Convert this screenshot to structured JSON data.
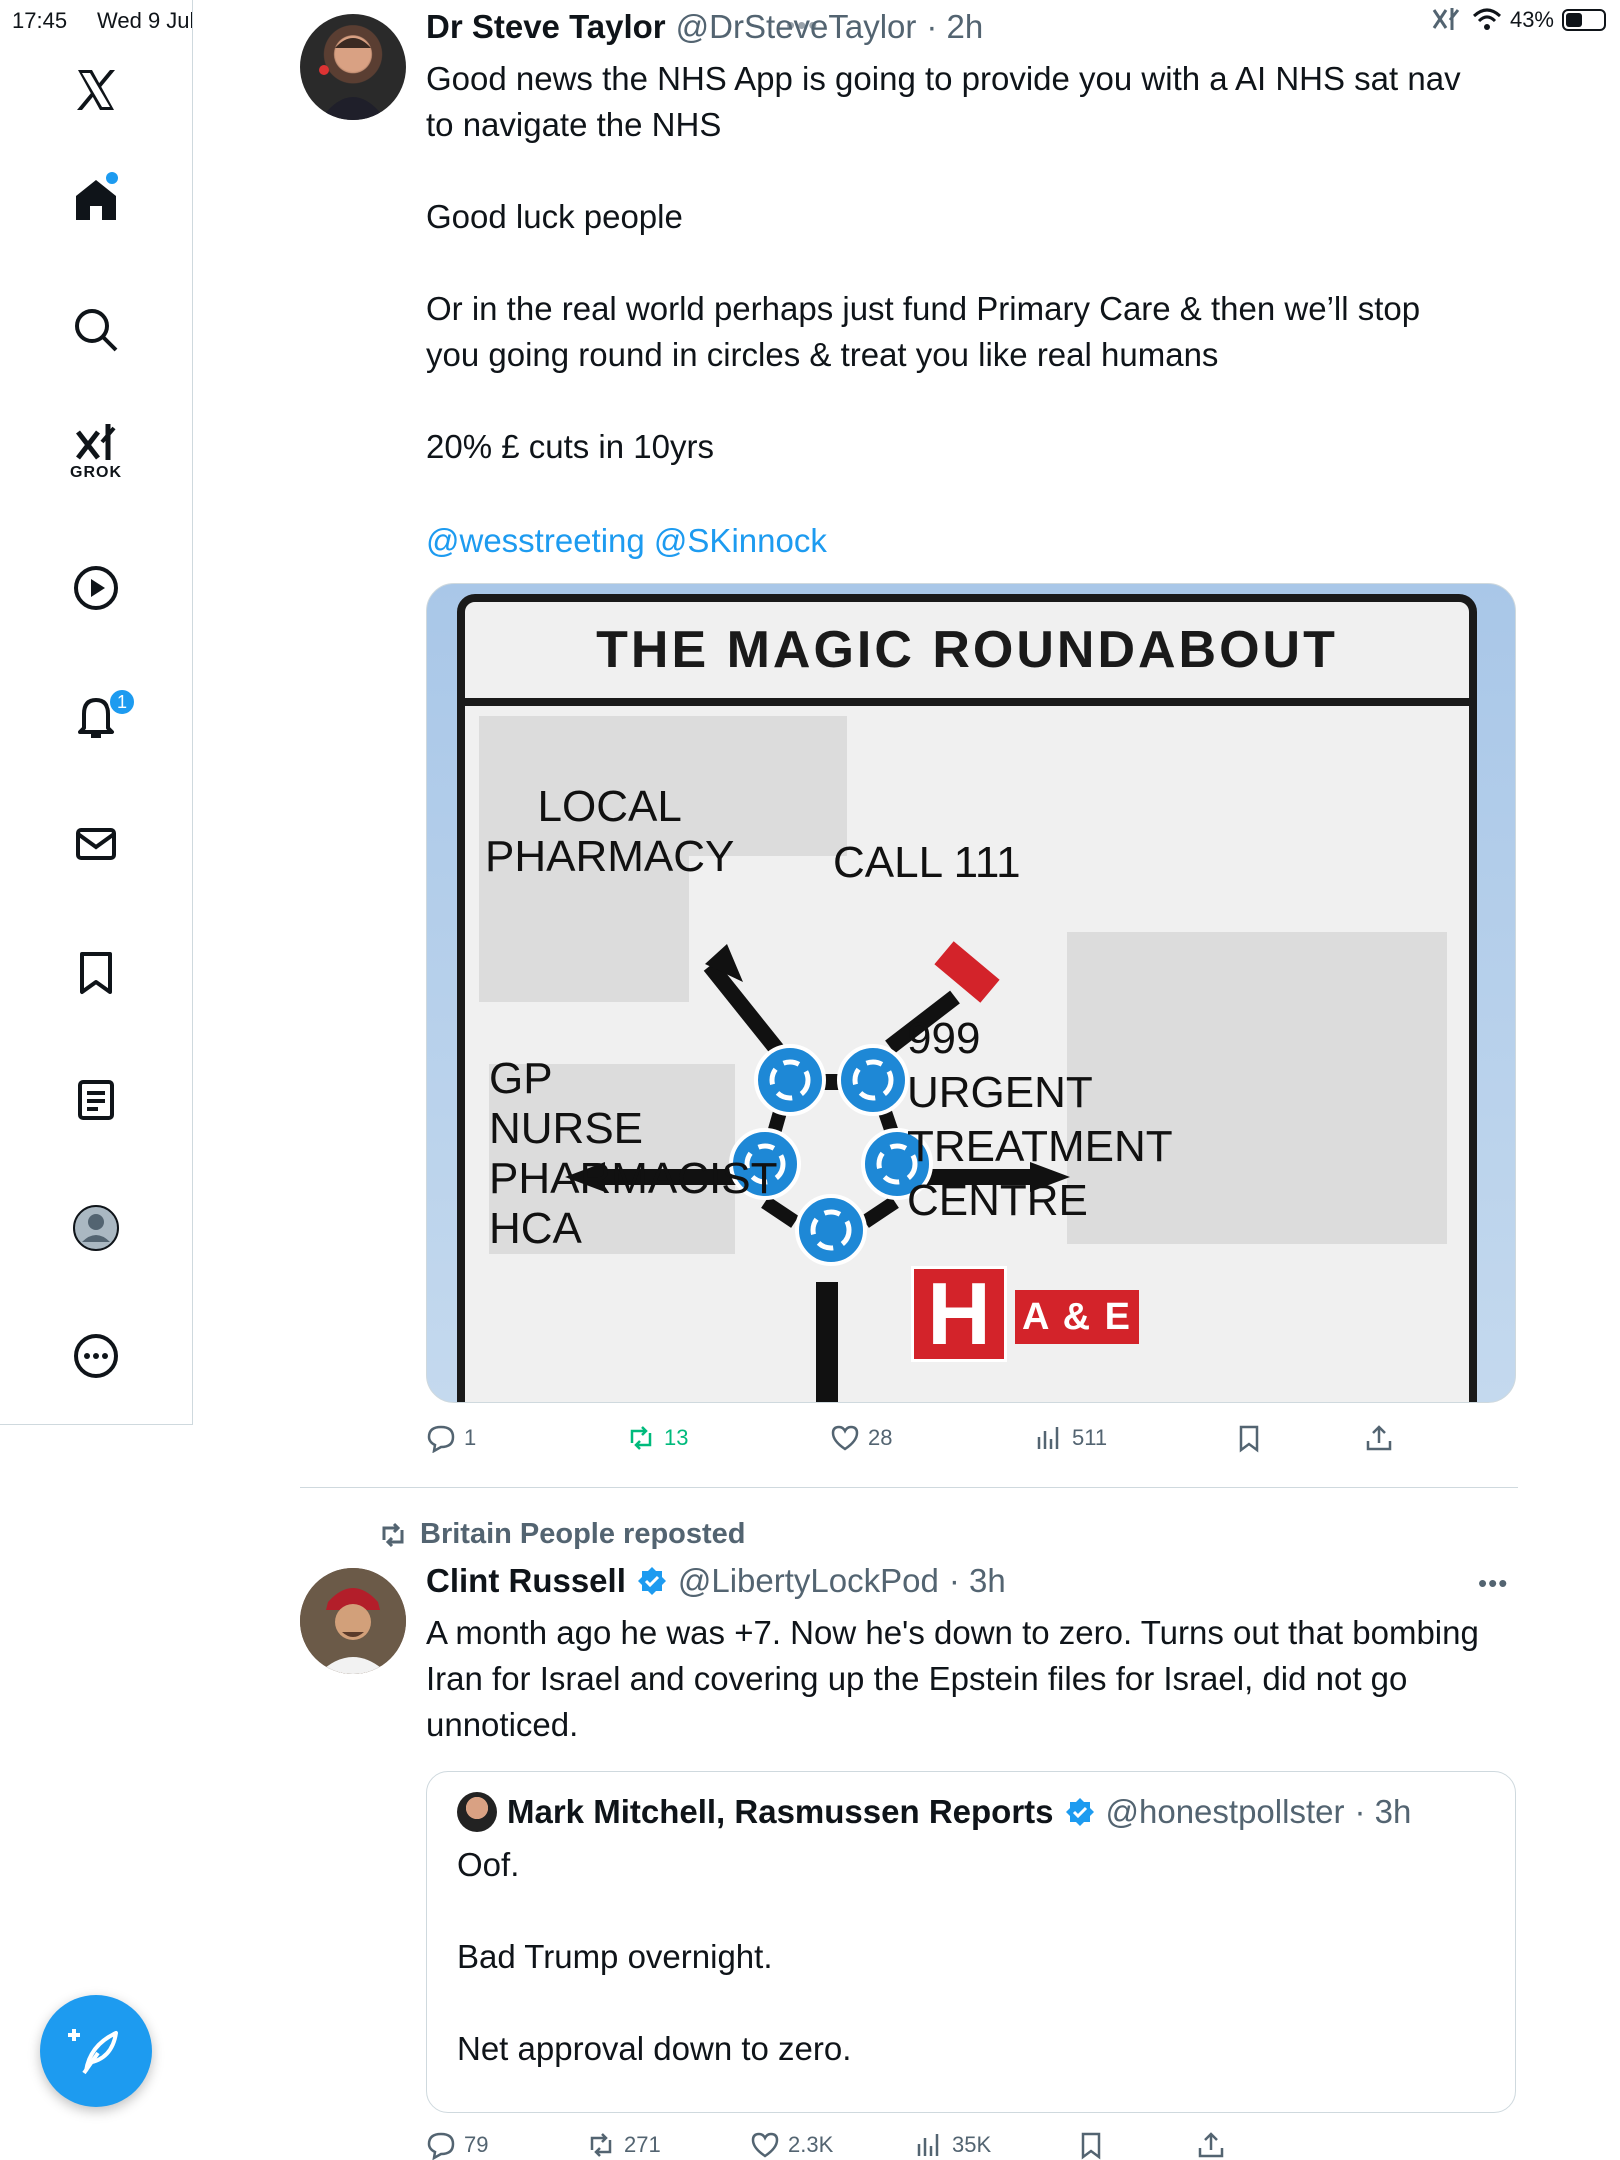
{
  "status_bar": {
    "time": "17:45",
    "date": "Wed 9 Jul",
    "battery": "43%"
  },
  "sidebar": {
    "items": [
      {
        "name": "x-logo"
      },
      {
        "name": "home"
      },
      {
        "name": "explore"
      },
      {
        "name": "grok",
        "label": "GROK"
      },
      {
        "name": "video"
      },
      {
        "name": "notifications",
        "badge": "1"
      },
      {
        "name": "messages"
      },
      {
        "name": "bookmarks"
      },
      {
        "name": "lists"
      },
      {
        "name": "profile"
      },
      {
        "name": "more"
      }
    ]
  },
  "post1": {
    "author": "Dr Steve Taylor",
    "handle": "@DrSteveTaylor",
    "time": "· 2h",
    "text": "Good news the NHS App is going to provide you with a AI NHS sat nav\nto navigate the NHS\n\nGood luck people\n\nOr in the real world perhaps just fund Primary Care & then we’ll stop\nyou going round in circles & treat you like real humans\n\n20% £ cuts in 10yrs",
    "mentions": "@wesstreeting @SKinnock",
    "image": {
      "title": "THE MAGIC ROUNDABOUT",
      "local": "LOCAL\nPHARMACY",
      "call": "CALL 111",
      "gp": "GP\nNURSE\nPHARMACIST\nHCA",
      "urgent": "999\nURGENT\nTREATMENT\nCENTRE",
      "h": "H",
      "ae": "A & E"
    },
    "stats": {
      "replies": "1",
      "reposts": "13",
      "likes": "28",
      "views": "511"
    }
  },
  "post2": {
    "reposted_by": "Britain People reposted",
    "author": "Clint Russell",
    "handle": "@LibertyLockPod",
    "time": "· 3h",
    "text": "A month ago he was +7. Now he's down to zero. Turns out that bombing\nIran for Israel and covering up the Epstein files for Israel, did not go\nunnoticed.",
    "quote": {
      "author": "Mark Mitchell, Rasmussen Reports",
      "handle": "@honestpollster",
      "time": "· 3h",
      "text": "Oof.\n\nBad Trump overnight.\n\nNet approval down to zero."
    },
    "stats": {
      "replies": "79",
      "reposts": "271",
      "likes": "2.3K",
      "views": "35K"
    }
  },
  "colors": {
    "accent": "#1d9bf0",
    "repost_green": "#00ba7c",
    "muted": "#536471"
  }
}
